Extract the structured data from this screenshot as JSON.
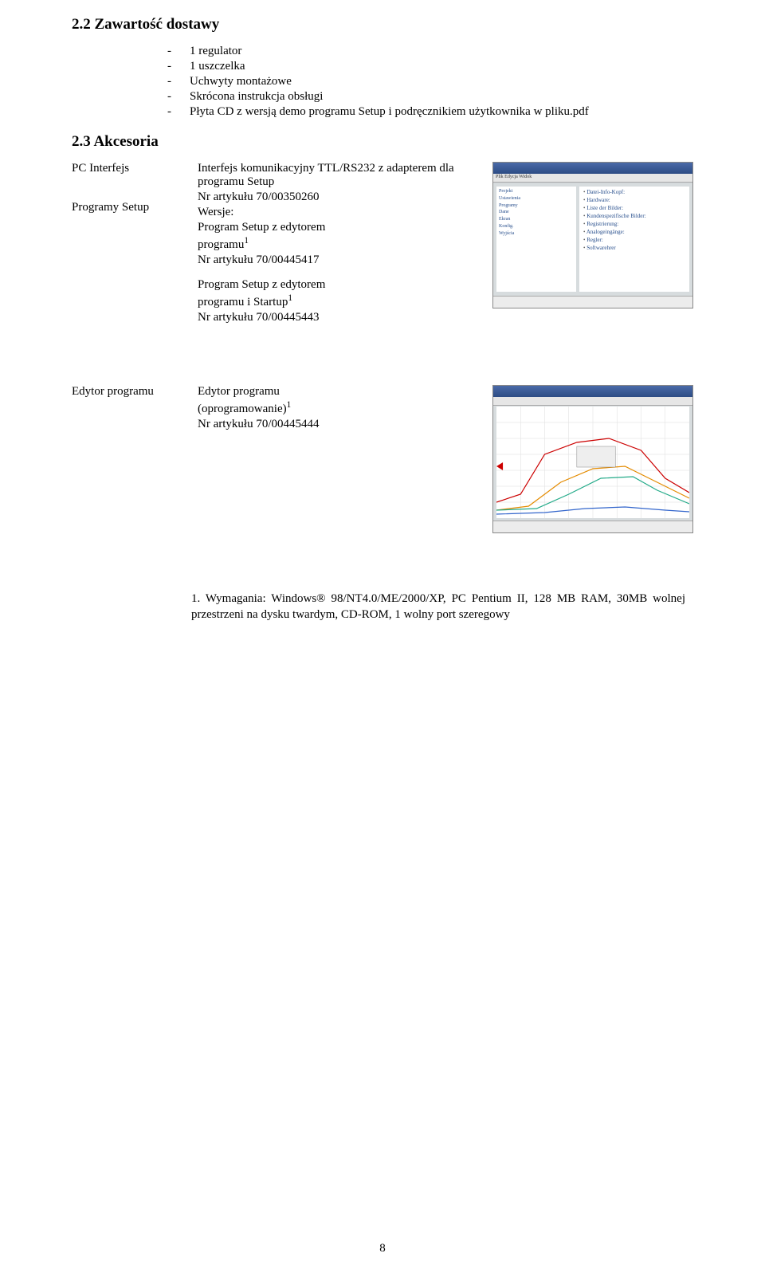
{
  "sections": {
    "delivery_heading": "2.2 Zawartość dostawy",
    "accessories_heading": "2.3 Akcesoria"
  },
  "delivery_items": [
    "1 regulator",
    "1 uszczelka",
    "Uchwyty montażowe",
    "Skrócona instrukcja obsługi",
    "Płyta CD z wersją demo programu Setup i podręcznikiem użytkownika w pliku.pdf"
  ],
  "accessories": {
    "pc_interface": {
      "label": "PC Interfejs",
      "line1": "Interfejs komunikacyjny TTL/RS232 z adapterem dla programu Setup",
      "line2": "Nr artykułu 70/00350260"
    },
    "setup_programs": {
      "label": "Programy Setup",
      "line1": "Wersje:",
      "line2": "Program Setup z edytorem",
      "line3_pre": "programu",
      "line3_sup": "1",
      "line4": "Nr artykułu 70/00445417",
      "line5": "Program Setup z edytorem",
      "line6_pre": "programu i Startup",
      "line6_sup": "1",
      "line7": "Nr artykułu 70/00445443"
    }
  },
  "editor": {
    "label": "Edytor programu",
    "line1": "Edytor programu",
    "line2_pre": "(oprogramowanie)",
    "line2_sup": "1",
    "line3": "Nr artykułu 70/00445444"
  },
  "footnote": "1. Wymagania: Windows® 98/NT4.0/ME/2000/XP, PC Pentium II, 128 MB RAM, 30MB wolnej przestrzeni na dysku twardym, CD-ROM, 1 wolny port szeregowy",
  "page_number": "8",
  "screenshot1": {
    "menu": "Plik Edycja Widok",
    "tree": [
      "Projekt",
      "Ustawienia",
      "Programy",
      "Dane",
      "Ekran",
      "Konfig.",
      "Wyjścia"
    ],
    "right": [
      "Datei-Info-Kopf:",
      "Hardware:",
      "Liste der Bilder:",
      "Kundenspezifische Bilder:",
      "Registrierung:",
      "Analogeingänge:",
      "Regler:",
      "Softwarehrer"
    ]
  }
}
